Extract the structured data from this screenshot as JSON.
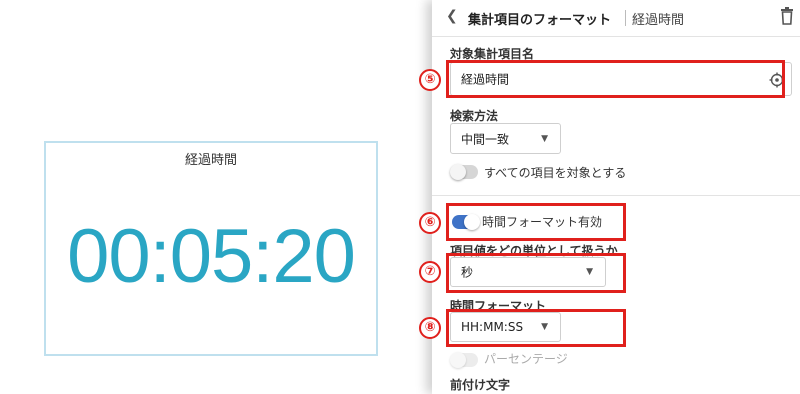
{
  "preview": {
    "title": "経過時間",
    "value": "00:05:20"
  },
  "panel": {
    "back_icon": "chevron-left-icon",
    "title": "集計項目のフォーマット",
    "subtitle": "経過時間",
    "delete_icon": "trash-icon",
    "target_item": {
      "label": "対象集計項目名",
      "value": "経過時間",
      "icon": "target-settings-icon"
    },
    "search_method": {
      "label": "検索方法",
      "value": "中間一致"
    },
    "all_items_toggle": {
      "label": "すべての項目を対象とする",
      "on": false
    },
    "time_format_toggle": {
      "label": "時間フォーマット有効",
      "on": true
    },
    "unit": {
      "label": "項目値をどの単位として扱うか",
      "value": "秒"
    },
    "time_format": {
      "label": "時間フォーマット",
      "value": "HH:MM:SS"
    },
    "percentage_toggle": {
      "label": "パーセンテージ",
      "on": false,
      "disabled": true
    },
    "prefix": {
      "label": "前付け文字"
    }
  },
  "callouts": {
    "five": "⑤",
    "six": "⑥",
    "seven": "⑦",
    "eight": "⑧",
    "color": "#e0201c"
  },
  "colors": {
    "accent": "#3f73c7",
    "preview_value": "#2aa6c4",
    "preview_border": "#bfe0ee"
  }
}
